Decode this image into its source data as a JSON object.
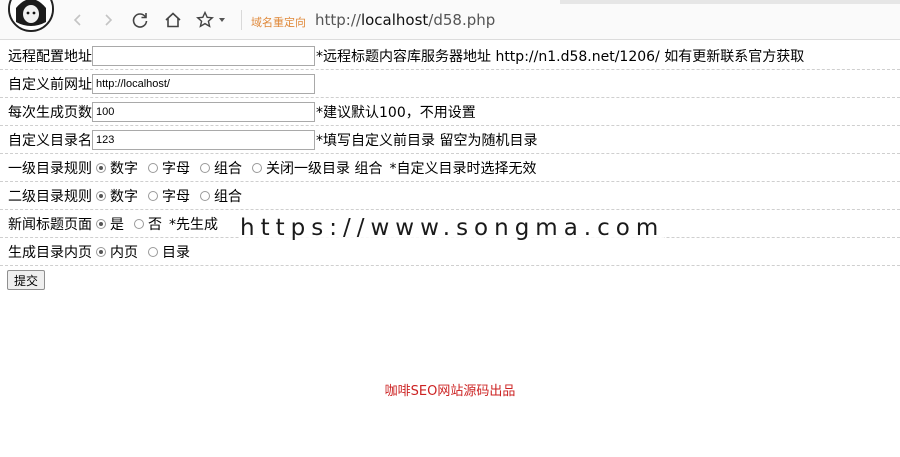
{
  "browser": {
    "tag": "域名重定向",
    "url_prefix": "http://",
    "url_host": "localhost",
    "url_path": "/d58.php"
  },
  "form": {
    "remote_addr": {
      "label": "远程配置地址",
      "value": "",
      "hint": "*远程标题内容库服务器地址 http://n1.d58.net/1206/ 如有更新联系官方获取"
    },
    "custom_url": {
      "label": "自定义前网址",
      "value": "http://localhost/"
    },
    "pages": {
      "label": "每次生成页数",
      "value": "100",
      "hint": "*建议默认100，不用设置"
    },
    "dir_name": {
      "label": "自定义目录名",
      "value": "123",
      "hint": "*填写自定义前目录 留空为随机目录"
    },
    "level1": {
      "label": "一级目录规则",
      "options": [
        "数字",
        "字母",
        "组合",
        "关闭一级目录 组合"
      ],
      "selected": 0,
      "hint": "*自定义目录时选择无效"
    },
    "level2": {
      "label": "二级目录规则",
      "options": [
        "数字",
        "字母",
        "组合"
      ],
      "selected": 0
    },
    "news_title": {
      "label": "新闻标题页面",
      "options": [
        "是",
        "否"
      ],
      "selected": 0,
      "hint": "*先生成"
    },
    "gen_dir": {
      "label": "生成目录内页",
      "options": [
        "内页",
        "目录"
      ],
      "selected": 0
    },
    "submit_label": "提交"
  },
  "watermark": "https://www.songma.com",
  "credit": "咖啡SEO网站源码出品",
  "colors": {
    "credit": "#cc2222",
    "tag": "#e0893a"
  }
}
